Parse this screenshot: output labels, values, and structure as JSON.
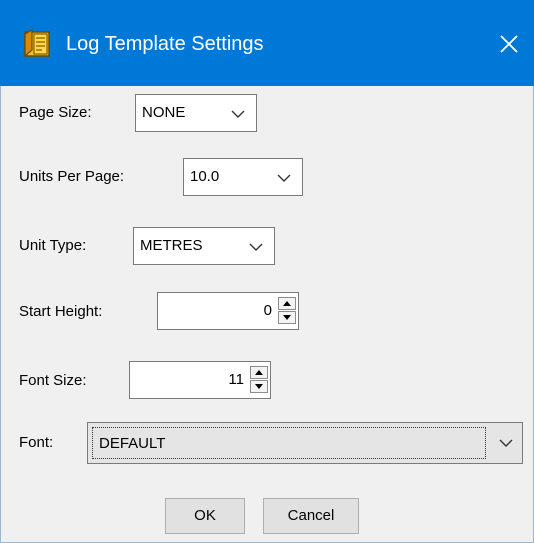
{
  "window": {
    "title": "Log Template Settings",
    "accent_color": "#0078d7",
    "icon": "log-template-icon"
  },
  "form": {
    "page_size": {
      "label": "Page Size:",
      "value": "NONE"
    },
    "units_per_page": {
      "label": "Units Per Page:",
      "value": "10.0"
    },
    "unit_type": {
      "label": "Unit Type:",
      "value": "METRES"
    },
    "start_height": {
      "label": "Start Height:",
      "value": "0"
    },
    "font_size": {
      "label": "Font Size:",
      "value": "11"
    },
    "font": {
      "label": "Font:",
      "value": "DEFAULT"
    }
  },
  "buttons": {
    "ok_label": "OK",
    "cancel_label": "Cancel"
  }
}
